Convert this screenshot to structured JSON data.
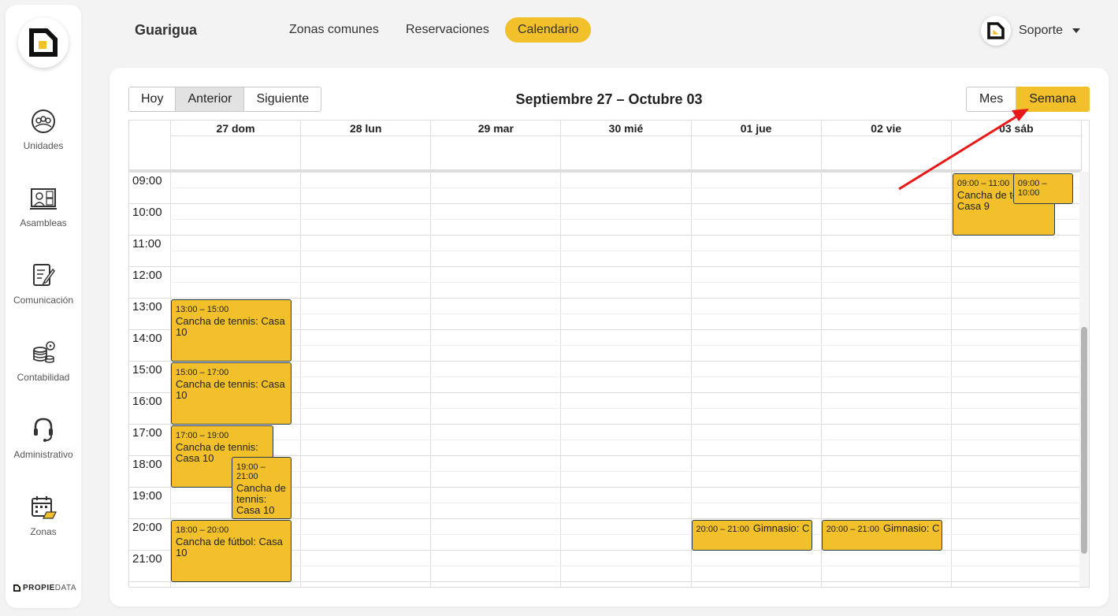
{
  "colors": {
    "accent": "#f2c02b",
    "event_border": "#2a3a4a",
    "annotation_arrow": "#e81818"
  },
  "sidebar": {
    "items": [
      {
        "label": "Unidades",
        "icon": "users-circle-icon"
      },
      {
        "label": "Asambleas",
        "icon": "video-meeting-icon"
      },
      {
        "label": "Comunicación",
        "icon": "document-edit-icon"
      },
      {
        "label": "Contabilidad",
        "icon": "coins-icon"
      },
      {
        "label": "Administrativo",
        "icon": "headset-icon"
      },
      {
        "label": "Zonas",
        "icon": "calendar-zone-icon"
      }
    ],
    "brand_bold": "PROPIE",
    "brand_light": "DATA"
  },
  "header": {
    "org_name": "Guarigua",
    "nav": [
      {
        "label": "Zonas comunes",
        "active": false
      },
      {
        "label": "Reservaciones",
        "active": false
      },
      {
        "label": "Calendario",
        "active": true
      }
    ],
    "user_name": "Soporte"
  },
  "calendar": {
    "nav_buttons": [
      "Hoy",
      "Anterior",
      "Siguiente"
    ],
    "range_title": "Septiembre 27 – Octubre 03",
    "view_buttons": [
      "Mes",
      "Semana"
    ],
    "active_view": "Semana",
    "days": [
      "27 dom",
      "28 lun",
      "29 mar",
      "30 mié",
      "01 jue",
      "02 vie",
      "03 sáb"
    ],
    "hours": [
      "09:00",
      "10:00",
      "11:00",
      "12:00",
      "13:00",
      "14:00",
      "15:00",
      "16:00",
      "17:00",
      "18:00",
      "19:00",
      "20:00",
      "21:00"
    ],
    "events": [
      {
        "time": "13:00 – 15:00",
        "name": "Cancha de tennis: Casa 10"
      },
      {
        "time": "15:00 – 17:00",
        "name": "Cancha de tennis: Casa 10"
      },
      {
        "time": "17:00 – 19:00",
        "name": "Cancha de tennis: Casa 10"
      },
      {
        "time": "18:00 – 20:00",
        "name": "Cancha de fútbol: Casa 10"
      },
      {
        "time": "19:00 – 21:00",
        "name": "Cancha de tennis: Casa 10"
      },
      {
        "time": "20:00 – 21:00",
        "name": "Gimnasio: C"
      },
      {
        "time": "20:00 – 21:00",
        "name": "Gimnasio: C"
      },
      {
        "time": "09:00 – 11:00",
        "name": "Cancha de tennis: Casa 9"
      },
      {
        "time": "09:00 – 10:00",
        "name": ""
      }
    ]
  }
}
